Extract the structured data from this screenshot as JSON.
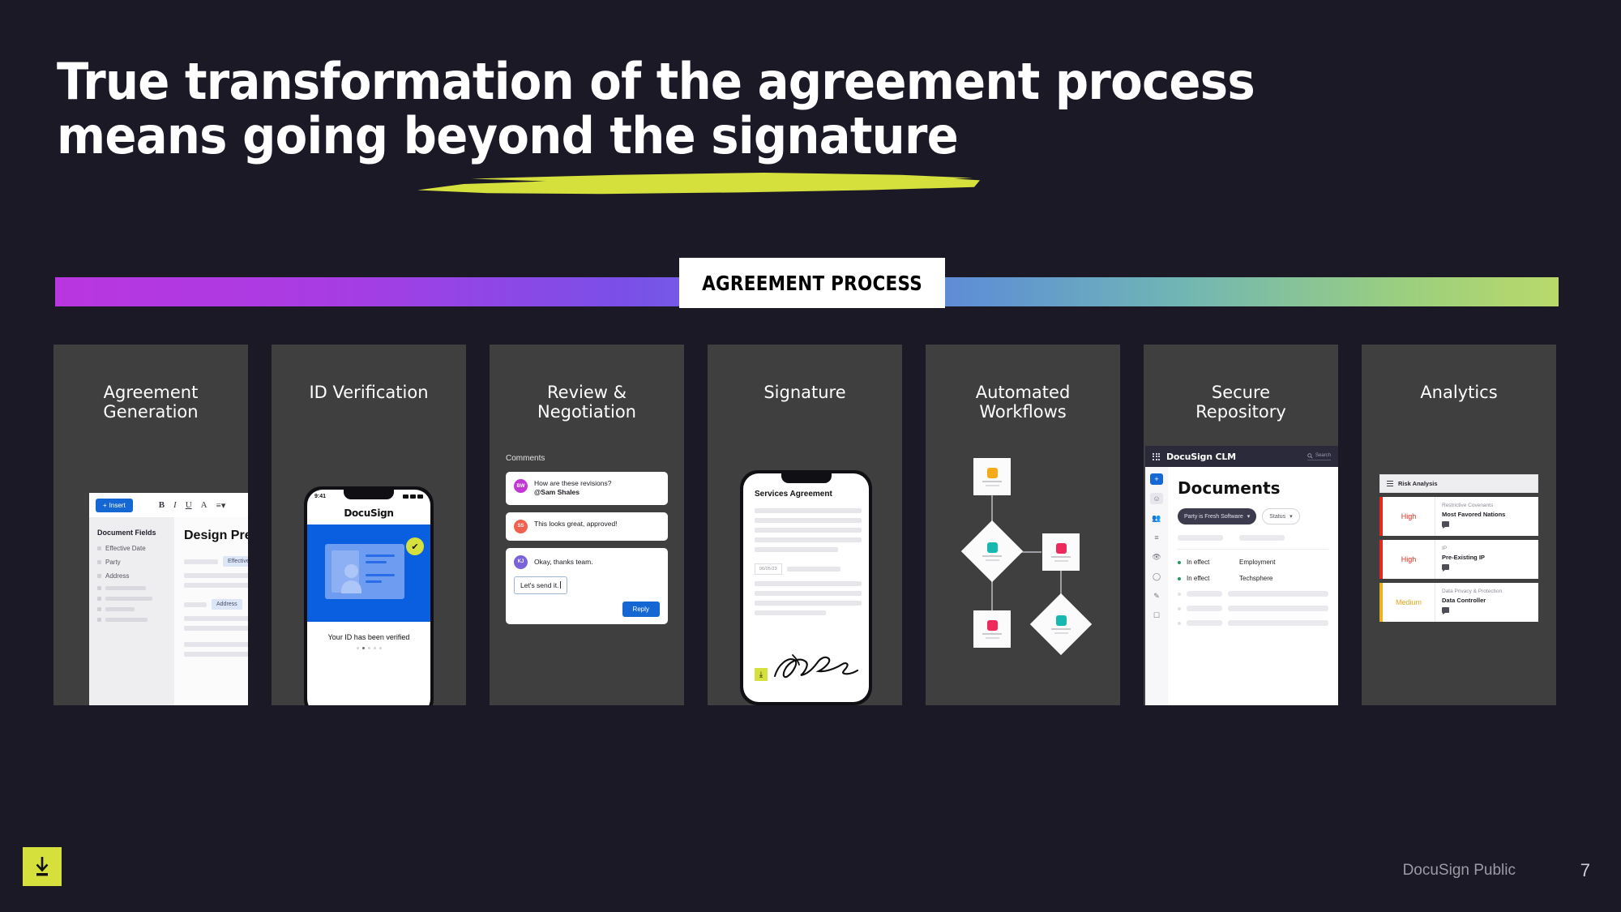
{
  "slide": {
    "title": "True transformation of the agreement process\nmeans going beyond the signature",
    "process_label": "AGREEMENT PROCESS",
    "footer_note": "DocuSign Public",
    "page_number": "7",
    "download_icon": "download-icon"
  },
  "colors": {
    "background": "#1b1926",
    "card": "#3f3f3f",
    "highlight": "#d5e03c",
    "accent_blue": "#1567d3",
    "gradient_start": "#b936e0",
    "gradient_mid": "#6673e2",
    "gradient_end": "#b9d96a"
  },
  "cards": [
    {
      "title": "Agreement\nGeneration"
    },
    {
      "title": "ID Verification"
    },
    {
      "title": "Review &\nNegotiation"
    },
    {
      "title": "Signature"
    },
    {
      "title": "Automated\nWorkflows"
    },
    {
      "title": "Secure\nRepository"
    },
    {
      "title": "Analytics"
    }
  ],
  "agreement_generation": {
    "insert_button": "Insert",
    "toolbar_icons": [
      "B",
      "I",
      "U",
      "A",
      "align-icon"
    ],
    "fields_heading": "Document Fields",
    "fields": [
      "Effective Date",
      "Party",
      "Address"
    ],
    "doc_title": "Design Pre",
    "tag_effective": "Effective",
    "tag_address": "Address"
  },
  "id_verification": {
    "status_time": "9:41",
    "brand": "DocuSign",
    "verified_text": "Your ID has been verified",
    "check_icon": "check-icon"
  },
  "review_negotiation": {
    "heading": "Comments",
    "comments": [
      {
        "initials": "BW",
        "color": "#c336d6",
        "text": "How are these revisions?",
        "mention": "@Sam Shales"
      },
      {
        "initials": "SS",
        "color": "#f0604f",
        "text": "This looks great, approved!"
      },
      {
        "initials": "KJ",
        "color": "#7b62d8",
        "text": "Okay, thanks team."
      }
    ],
    "draft_value": "Let's send it.",
    "reply_button": "Reply"
  },
  "signature": {
    "doc_title": "Services Agreement",
    "date_value": "06/05/23",
    "download_icon": "download-icon",
    "signature_alt": "handwritten-signature"
  },
  "automated_workflows": {
    "nodes": [
      {
        "shape": "square",
        "color": "#f4ab16"
      },
      {
        "shape": "diamond",
        "color": "#16b8b0"
      },
      {
        "shape": "square",
        "color": "#ee2a5d"
      },
      {
        "shape": "square",
        "color": "#ee2a5d"
      },
      {
        "shape": "diamond",
        "color": "#16b8b0"
      }
    ]
  },
  "secure_repository": {
    "app_name": "DocuSign CLM",
    "search_placeholder": "Search",
    "page_heading": "Documents",
    "filters": [
      "Party is Fresh Software",
      "Status"
    ],
    "rows": [
      {
        "status": "In effect",
        "name": "Employment"
      },
      {
        "status": "In effect",
        "name": "Techsphere"
      }
    ]
  },
  "analytics": {
    "panel_title": "Risk Analysis",
    "rows": [
      {
        "level": "High",
        "category": "Restrictive Covenants",
        "clause": "Most Favored Nations"
      },
      {
        "level": "High",
        "category": "IP",
        "clause": "Pre-Existing IP"
      },
      {
        "level": "Medium",
        "category": "Data Privacy & Protection",
        "clause": "Data Controller"
      }
    ]
  }
}
